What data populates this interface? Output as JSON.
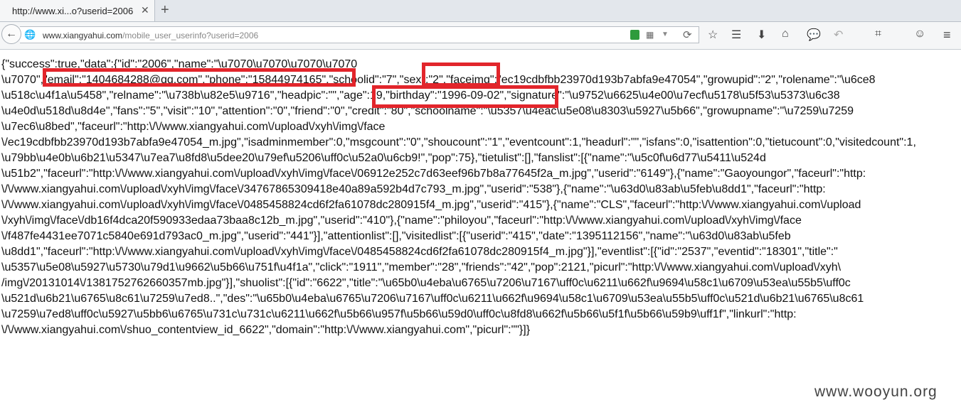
{
  "browser": {
    "tab_title": "http://www.xi...o?userid=2006",
    "tab_close": "✕",
    "new_tab": "+",
    "url_host": "www.xiangyahui.com",
    "url_path": "/mobile_user_userinfo?userid=2006",
    "back_glyph": "←",
    "globe_glyph": "🌐",
    "qr_glyph": "▦",
    "dropdown_glyph": "▼",
    "reload_glyph": "⟳",
    "toolbar": {
      "star": "☆",
      "reader": "☰",
      "download": "⬇",
      "home": "⌂",
      "chat": "💬",
      "undo": "↶",
      "crop": "⌗",
      "smile": "☺",
      "menu": "≡"
    }
  },
  "content": {
    "lines": [
      "{\"success\":true,\"data\":{\"id\":\"2006\",\"name\":\"\\u7070\\u7070\\u7070\\u7070",
      "\\u7070\",\"email\":\"1404684288@qq.com\",\"phone\":\"15844974165\",\"schoolid\":\"7\",\"sex\":\"2\",\"faceimg\":\"ec19cdbfbb23970d193b7abfa9e47054\",\"growupid\":\"2\",\"rolename\":\"\\u6ce8",
      "\\u518c\\u4f1a\\u5458\",\"relname\":\"\\u738b\\u82e5\\u9716\",\"headpic\":\"\",\"age\":19,\"birthday\":\"1996-09-02\",\"signature\":\"\\u9752\\u6625\\u4e00\\u7ecf\\u5178\\u5f53\\u5373\\u6c38",
      "\\u4e0d\\u518d\\u8d4e\",\"fans\":\"5\",\"visit\":\"10\",\"attention\":\"0\",\"friend\":\"0\",\"credit\":\"80\",\"schoolname\":\"\\u5357\\u4eac\\u5e08\\u8303\\u5927\\u5b66\",\"growupname\":\"\\u7259\\u7259",
      "\\u7ec6\\u8bed\",\"faceurl\":\"http:\\/\\/www.xiangyahui.com\\/upload\\/xyh\\/img\\/face",
      "\\/ec19cdbfbb23970d193b7abfa9e47054_m.jpg\",\"isadminmember\":0,\"msgcount\":\"0\",\"shoucount\":\"1\",\"eventcount\":1,\"headurl\":\"\",\"isfans\":0,\"isattention\":0,\"tietucount\":0,\"visitedcount\":1,",
      "\\u79bb\\u4e0b\\u6b21\\u5347\\u7ea7\\u8fd8\\u5dee20\\u79ef\\u5206\\uff0c\\u52a0\\u6cb9!\",\"pop\":75},\"tietulist\":[],\"fanslist\":[{\"name\":\"\\u5c0f\\u6d77\\u5411\\u524d",
      "\\u51b2\",\"faceurl\":\"http:\\/\\/www.xiangyahui.com\\/upload\\/xyh\\/img\\/face\\/06912e252c7d63eef96b7b8a77645f2a_m.jpg\",\"userid\":\"6149\"},{\"name\":\"Gaoyoungor\",\"faceurl\":\"http:",
      "\\/\\/www.xiangyahui.com\\/upload\\/xyh\\/img\\/face\\/34767865309418e40a89a592b4d7c793_m.jpg\",\"userid\":\"538\"},{\"name\":\"\\u63d0\\u83ab\\u5feb\\u8dd1\",\"faceurl\":\"http:",
      "\\/\\/www.xiangyahui.com\\/upload\\/xyh\\/img\\/face\\/0485458824cd6f2fa61078dc280915f4_m.jpg\",\"userid\":\"415\"},{\"name\":\"CLS\",\"faceurl\":\"http:\\/\\/www.xiangyahui.com\\/upload",
      "\\/xyh\\/img\\/face\\/db16f4dca20f590933edaa73baa8c12b_m.jpg\",\"userid\":\"410\"},{\"name\":\"philoyou\",\"faceurl\":\"http:\\/\\/www.xiangyahui.com\\/upload\\/xyh\\/img\\/face",
      "\\/f487fe4431ee7071c5840e691d793ac0_m.jpg\",\"userid\":\"441\"}],\"attentionlist\":[],\"visitedlist\":[{\"userid\":\"415\",\"date\":\"1395112156\",\"name\":\"\\u63d0\\u83ab\\u5feb",
      "\\u8dd1\",\"faceurl\":\"http:\\/\\/www.xiangyahui.com\\/upload\\/xyh\\/img\\/face\\/0485458824cd6f2fa61078dc280915f4_m.jpg\"}],\"eventlist\":[{\"id\":\"2537\",\"eventid\":\"18301\",\"title\":\"",
      "\\u5357\\u5e08\\u5927\\u5730\\u79d1\\u9662\\u5b66\\u751f\\u4f1a\",\"click\":\"1911\",\"member\":\"28\",\"friends\":\"42\",\"pop\":2121,\"picurl\":\"http:\\/\\/www.xiangyahui.com\\/upload\\/xyh\\",
      "/img\\/20131014\\/1381752762660357mb.jpg\"}],\"shuolist\":[{\"id\":\"6622\",\"title\":\"\\u65b0\\u4eba\\u6765\\u7206\\u7167\\uff0c\\u6211\\u662f\\u9694\\u58c1\\u6709\\u53ea\\u55b5\\uff0c",
      "\\u521d\\u6b21\\u6765\\u8c61\\u7259\\u7ed8..\",\"des\":\"\\u65b0\\u4eba\\u6765\\u7206\\u7167\\uff0c\\u6211\\u662f\\u9694\\u58c1\\u6709\\u53ea\\u55b5\\uff0c\\u521d\\u6b21\\u6765\\u8c61",
      "\\u7259\\u7ed8\\uff0c\\u5927\\u5bb6\\u6765\\u731c\\u731c\\u6211\\u662f\\u5b66\\u957f\\u5b66\\u59d0\\uff0c\\u8fd8\\u662f\\u5b66\\u5f1f\\u5b66\\u59b9\\uff1f\",\"linkurl\":\"http:",
      "\\/\\/www.xiangyahui.com\\/shuo_contentview_id_6622\",\"domain\":\"http:\\/\\/www.xiangyahui.com\",\"picurl\":\"\"}]}"
    ]
  },
  "highlight_color": "#e2252b",
  "watermark": "www.wooyun.org"
}
